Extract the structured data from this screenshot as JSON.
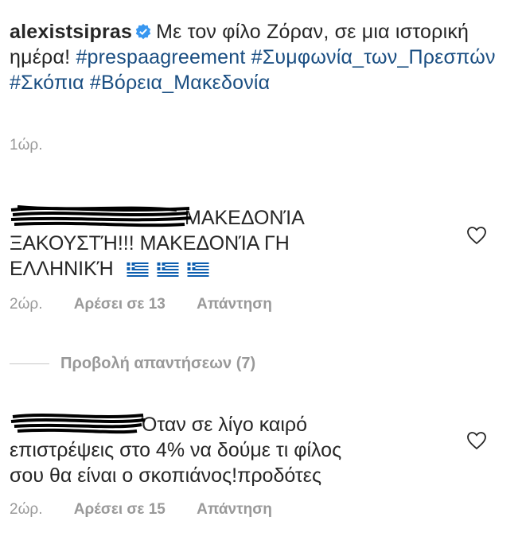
{
  "post": {
    "username": "alexistsipras",
    "caption_text": "Με τον φίλο Ζόραν, σε μια ιστορική ημέρα!",
    "hashtags": [
      "#prespaagreement",
      "#Συμφωνία_των_Πρεσπών",
      "#Σκόπια",
      "#Βόρεια_Μακεδονία"
    ],
    "time": "1ώρ."
  },
  "comments": [
    {
      "text_line1": "ΜΑΚΕΔΟΝΊΑ",
      "text_line2": "ΞΑΚΟΥΣΤΉ!!! ΜΑΚΕΔΟΝΊΑ ΓΗ",
      "text_line3": "ΕΛΛΗΝΙΚΉ",
      "flags": [
        "greek-flag",
        "greek-flag",
        "greek-flag"
      ],
      "time": "2ώρ.",
      "likes": "Αρέσει σε 13",
      "reply": "Απάντηση"
    },
    {
      "text_line1": "Όταν σε λίγο καιρό",
      "text_line2": "επιστρέψεις στο 4% να δούμε τι φίλος",
      "text_line3": "σου θα είναι ο σκοπιάνος!προδότες",
      "time": "2ώρ.",
      "likes": "Αρέσει σε 15",
      "reply": "Απάντηση"
    }
  ],
  "view_replies": "Προβολή απαντήσεων (7)",
  "colors": {
    "hashtag": "#1a4e82",
    "meta": "#999999",
    "verified": "#3897f0"
  }
}
